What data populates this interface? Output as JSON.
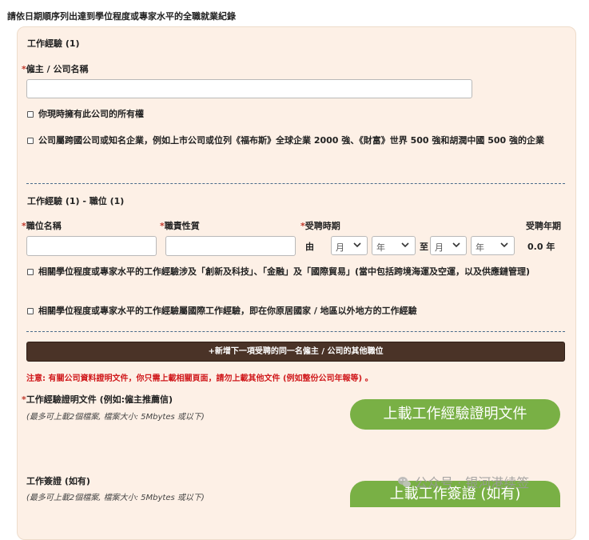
{
  "intro_text": "請依日期順序列出達到學位程度或專家水平的全職就業紀錄",
  "work": {
    "section_title": "工作經驗 (1)",
    "employer_label": "僱主 / 公司名稱",
    "employer_value": "",
    "checkbox_owner": "你現時擁有此公司的所有權",
    "checkbox_multinational": "公司屬跨國公司或知名企業，例如上市公司或位列《福布斯》全球企業 2000 強、《財富》世界 500 強和胡潤中國 500 強的企業"
  },
  "position": {
    "section_title": "工作經驗 (1) - 職位 (1)",
    "title_label": "職位名稱",
    "duty_label": "職責性質",
    "period_label": "受聘時期",
    "years_label": "受聘年期",
    "from_label": "由",
    "to_label": "至",
    "from_month": "月",
    "from_year": "年",
    "to_month": "月",
    "to_year": "年",
    "years_value": "0.0 年",
    "checkbox_fields": "相關學位程度或專家水平的工作經驗涉及「創新及科技」、「金融」及「國際貿易」(當中包括跨境海運及空運，以及供應鏈管理)",
    "checkbox_international": "相關學位程度或專家水平的工作經驗屬國際工作經驗，即在你原居國家 / 地區以外地方的工作經驗"
  },
  "add_button": "+新增下一項受聘的同一名僱主 / 公司的其他職位",
  "notice": "注意: 有關公司資料證明文件，你只需上載相關頁面，請勿上載其他文件 (例如整份公司年報等) 。",
  "proof": {
    "label": "工作經驗證明文件 (例如:僱主推薦信)",
    "hint": "(最多可上載2個檔案, 檔案大小: 5Mbytes 或以下)",
    "button": "上載工作經驗證明文件"
  },
  "visa": {
    "label": "工作簽證 (如有)",
    "hint": "(最多可上載2個檔案, 檔案大小: 5Mbytes 或以下)",
    "button": "上載工作簽證 (如有)"
  },
  "watermark": "公众号 · 银河港续签",
  "colors": {
    "panel_bg": "#fdf0e6",
    "add_button_bg": "#4a3327",
    "upload_button_bg": "#79b045",
    "required": "#c0392b",
    "notice": "#d0191c"
  },
  "icons": [
    "chevron-down-icon",
    "wechat-icon"
  ]
}
